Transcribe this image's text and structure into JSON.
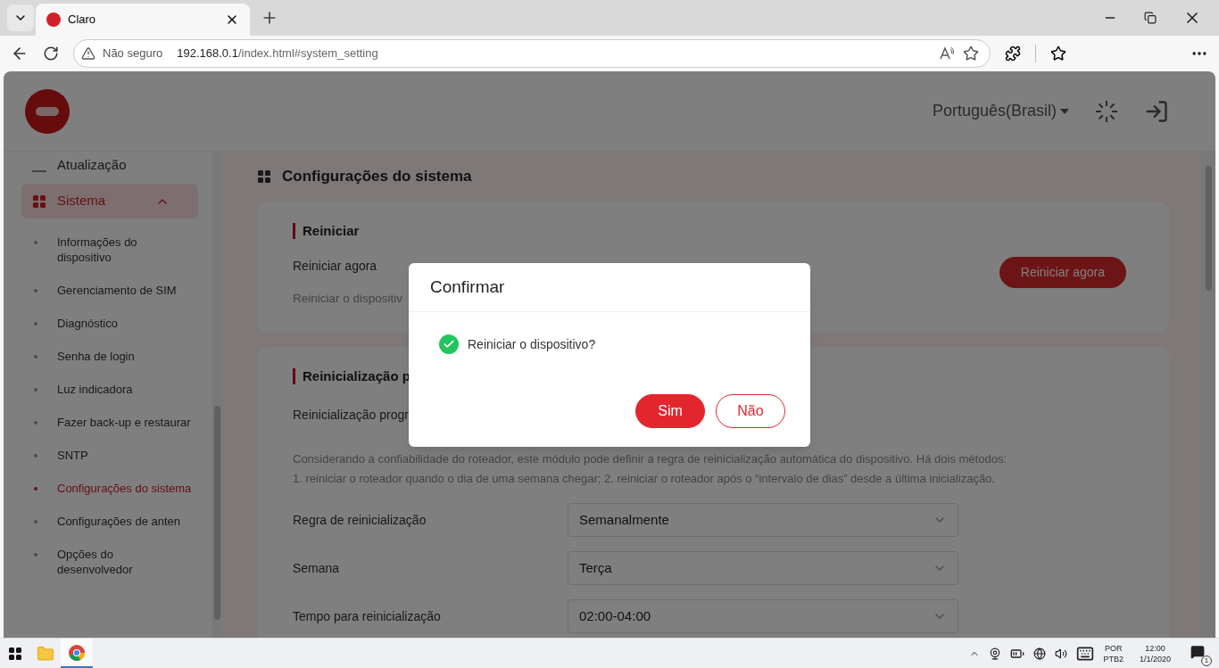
{
  "browser": {
    "tab": {
      "title": "Claro"
    },
    "security": "Não seguro",
    "url_host": "192.168.0.1",
    "url_path": "/index.html#system_setting"
  },
  "header": {
    "language": "Português(Brasil)"
  },
  "sidebar": {
    "items": [
      {
        "label": "Atualização",
        "selected": false
      },
      {
        "label": "Sistema",
        "selected": true,
        "expanded": true,
        "children": [
          {
            "label": "Informações do dispositivo",
            "selected": false
          },
          {
            "label": "Gerenciamento de SIM",
            "selected": false
          },
          {
            "label": "Diagnóstico",
            "selected": false
          },
          {
            "label": "Senha de login",
            "selected": false
          },
          {
            "label": "Luz indicadora",
            "selected": false
          },
          {
            "label": "Fazer back-up e restaurar",
            "selected": false
          },
          {
            "label": "SNTP",
            "selected": false
          },
          {
            "label": "Configurações do sistema",
            "selected": true
          },
          {
            "label": "Configurações de anten",
            "selected": false
          },
          {
            "label": "Opções do desenvolvedor",
            "selected": false
          }
        ]
      }
    ]
  },
  "content": {
    "title": "Configurações do sistema",
    "restart_card": {
      "heading": "Reiniciar",
      "label": "Reiniciar agora",
      "description": "Reiniciar o dispositiv",
      "button": "Reiniciar agora"
    },
    "schedule_card": {
      "heading": "Reinicialização p",
      "label": "Reinicialização progr",
      "description_lines": [
        "Considerando a confiabilidade do roteador, este módulo pode definir a regra de reinicialização automática do dispositivo. Há dois métodos:",
        "1. reiniciar o roteador quando o dia de uma semana chegar; 2. reiniciar o roteador após o “intervalo de dias” desde a última inicialização."
      ],
      "fields": [
        {
          "label": "Regra de reinicialização",
          "value": "Semanalmente"
        },
        {
          "label": "Semana",
          "value": "Terça"
        },
        {
          "label": "Tempo para reinicialização",
          "value": "02:00-04:00"
        }
      ]
    }
  },
  "dialog": {
    "title": "Confirmar",
    "message": "Reiniciar o dispositivo?",
    "buttons": [
      {
        "label": "Sim",
        "kind": "primary"
      },
      {
        "label": "Não",
        "kind": "secondary"
      }
    ]
  },
  "taskbar": {
    "language": [
      "POR",
      "PTB2"
    ],
    "time": "12:00",
    "date": "1/1/2020",
    "notifications": "1"
  }
}
